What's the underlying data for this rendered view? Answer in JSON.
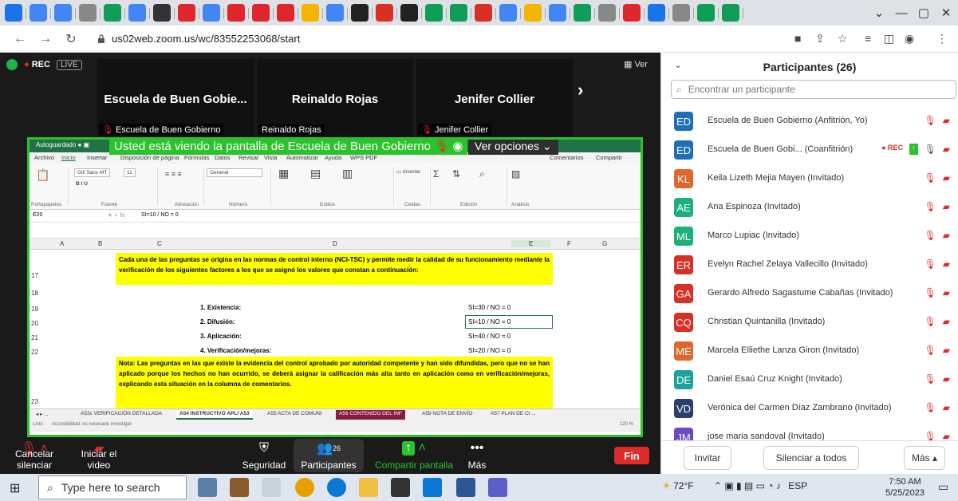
{
  "browser": {
    "url": "us02web.zoom.us/wc/83552253068/start",
    "tab_colors": [
      "#1a73e8",
      "#4285f4",
      "#4285f4",
      "#888888",
      "#0f9d58",
      "#4285f4",
      "#333333",
      "#e0262d",
      "#4285f4",
      "#e0262d",
      "#e0262d",
      "#e0262d",
      "#f4b400",
      "#4285f4",
      "#222222",
      "#d93025",
      "#222222",
      "#0f9d58",
      "#0f9d58",
      "#d93025",
      "#4285f4",
      "#f4b400",
      "#4285f4",
      "#0f9d58",
      "#888888",
      "#e0262d",
      "#1a73e8",
      "#888888",
      "#0f9d58",
      "#0f9d58"
    ]
  },
  "meeting": {
    "rec_label": "REC",
    "live_label": "LIVE",
    "view_label": "Ver",
    "tiles": [
      {
        "display_name": "Escuela de Buen Gobie...",
        "label": "Escuela de Buen Gobierno",
        "muted": true
      },
      {
        "display_name": "Reinaldo Rojas",
        "label": "Reinaldo Rojas",
        "muted": false
      },
      {
        "display_name": "Jenifer Collier",
        "label": "Jenifer Collier",
        "muted": true
      }
    ]
  },
  "share": {
    "banner": "Usted está viendo la pantalla de Escuela de Buen Gobierno",
    "options_label": "Ver opciones",
    "excel": {
      "autosave": "Autoguardado",
      "menu": [
        "Archivo",
        "Inicio",
        "Insertar",
        "Disposición de página",
        "Fórmulas",
        "Datos",
        "Revisar",
        "Vista",
        "Automatizar",
        "Ayuda",
        "WPS PDF"
      ],
      "comments": "Comentarios",
      "share": "Compartir",
      "font": "Gill Sans MT",
      "font_size": "11",
      "number_format": "General",
      "groups": [
        "Portapapeles",
        "Fuente",
        "Alineación",
        "Número",
        "Estilos",
        "Celdas",
        "Edición",
        "Análisis"
      ],
      "cell_ref": "E20",
      "formula": "SI=10 / NO = 0",
      "columns": [
        "A",
        "B",
        "C",
        "D",
        "E",
        "F",
        "G"
      ],
      "rows": [
        "17",
        "18",
        "19",
        "20",
        "21",
        "22",
        "23"
      ],
      "intro": "Cada una de las preguntas se origina en las normas de control interno (NCI-TSC) y permite medir la calidad de su funcionamiento mediante la verificación de los siguientes factores a los que se asignó los valores que constan a continuación:",
      "factors": [
        {
          "label": "1.  Existencia:",
          "value": "SI=30 / NO = 0"
        },
        {
          "label": "2.  Difusión:",
          "value": "SI=10 / NO = 0"
        },
        {
          "label": "3.  Aplicación:",
          "value": "SI=40 / NO = 0"
        },
        {
          "label": "4.  Verificación/mejoras:",
          "value": "SI=20 / NO = 0"
        }
      ],
      "note": "Nota: Las preguntas en las que existe la evidencia del control aprobado por autoridad competente y han sido difundidas, pero que no se han aplicado porque los hechos no han ocurrido, se deberá asignar la calificación más alta tanto en aplicación como en verificación/mejoras, explicando esta situación en la columna de comentarios.",
      "sheets": [
        "A53c VERIFICACIÓN DETALLADA",
        "A54 INSTRUCTIVO APLI A53",
        "A55 ACTA DE COMUNI",
        "A56 CONTENIDO DEL INF",
        "A59 NOTA DE ENVÍO",
        "A57 PLAN DE CI ..."
      ],
      "status_left": "Listo",
      "status_access": "Accesibilidad: es necesario investigar",
      "zoom": "120 %"
    }
  },
  "toolbar": {
    "items": [
      {
        "label": "Cancelar silenciar"
      },
      {
        "label": "Iniciar el video"
      },
      {
        "label": "Seguridad"
      },
      {
        "label": "Participantes",
        "count": "26"
      },
      {
        "label": "Compartir pantalla"
      },
      {
        "label": "Más"
      }
    ],
    "end_label": "Fin"
  },
  "panel": {
    "title": "Participantes (26)",
    "search_placeholder": "Encontrar un participante",
    "participants": [
      {
        "initials": "ED",
        "name": "Escuela de Buen Gobierno (Anfitrión, Yo)",
        "color": "#1e6fb8"
      },
      {
        "initials": "ED",
        "name": "Escuela de Buen Gobi... (Coanfitrión)",
        "color": "#1e6fb8",
        "rec": "REC"
      },
      {
        "initials": "KL",
        "name": "Keila Lizeth Mejia Mayen (Invitado)",
        "color": "#e0662a"
      },
      {
        "initials": "AE",
        "name": "Ana Espinoza (Invitado)",
        "color": "#1db07a"
      },
      {
        "initials": "ML",
        "name": "Marco Lupiac (Invitado)",
        "color": "#1db07a"
      },
      {
        "initials": "ER",
        "name": "Evelyn Rachel Zelaya Vallecillo (Invitado)",
        "color": "#d93025"
      },
      {
        "initials": "GA",
        "name": "Gerardo Alfredo Sagastume Cabañas (Invitado)",
        "color": "#d93025"
      },
      {
        "initials": "CQ",
        "name": "Christian Quintanilla (Invitado)",
        "color": "#d93025"
      },
      {
        "initials": "ME",
        "name": "Marcela Elliethe Lanza Giron (Invitado)",
        "color": "#e0662a"
      },
      {
        "initials": "DE",
        "name": "Daniel Esaú Cruz Knight (Invitado)",
        "color": "#1aa39a"
      },
      {
        "initials": "VD",
        "name": "Verónica del Carmen Díaz Zambrano (Invitado)",
        "color": "#2c3e6b"
      },
      {
        "initials": "JM",
        "name": "jose maria sandoval (Invitado)",
        "color": "#6a4bc4"
      }
    ],
    "invite": "Invitar",
    "mute_all": "Silenciar a todos",
    "more": "Más"
  },
  "taskbar": {
    "search_placeholder": "Type here to search",
    "temperature": "72°F",
    "language": "ESP",
    "time": "7:50 AM",
    "date": "5/25/2023"
  }
}
